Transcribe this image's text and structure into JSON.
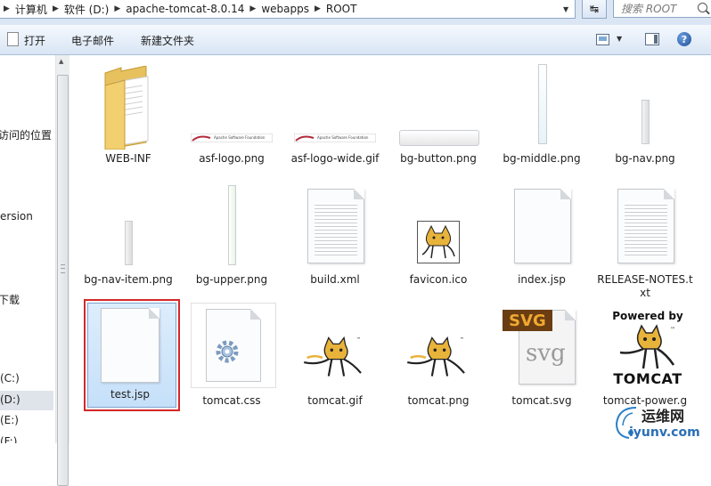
{
  "address_bar": {
    "crumbs": [
      "计算机",
      "软件 (D:)",
      "apache-tomcat-8.0.14",
      "webapps",
      "ROOT"
    ],
    "search_placeholder": "搜索 ROOT"
  },
  "toolbar": {
    "open_label": "打开",
    "email_label": "电子邮件",
    "new_folder_label": "新建文件夹"
  },
  "nav_pane": {
    "items": [
      "访问的位置",
      "ersion",
      "下载",
      "(C:)",
      "(D:)",
      "(E:)",
      "(F:)"
    ]
  },
  "files": [
    {
      "name": "WEB-INF",
      "icon": "folder-icon"
    },
    {
      "name": "asf-logo.png",
      "icon": "image-icon"
    },
    {
      "name": "asf-logo-wide.gif",
      "icon": "image-icon"
    },
    {
      "name": "bg-button.png",
      "icon": "image-icon"
    },
    {
      "name": "bg-middle.png",
      "icon": "image-icon"
    },
    {
      "name": "bg-nav.png",
      "icon": "image-icon"
    },
    {
      "name": "bg-nav-item.png",
      "icon": "image-icon"
    },
    {
      "name": "bg-upper.png",
      "icon": "image-icon"
    },
    {
      "name": "build.xml",
      "icon": "document-icon"
    },
    {
      "name": "favicon.ico",
      "icon": "tomcat-icon"
    },
    {
      "name": "index.jsp",
      "icon": "document-icon"
    },
    {
      "name": "RELEASE-NOTES.txt",
      "icon": "document-icon"
    },
    {
      "name": "test.jsp",
      "icon": "document-icon",
      "selected": true
    },
    {
      "name": "tomcat.css",
      "icon": "css-icon"
    },
    {
      "name": "tomcat.gif",
      "icon": "tomcat-icon"
    },
    {
      "name": "tomcat.png",
      "icon": "tomcat-icon"
    },
    {
      "name": "tomcat.svg",
      "icon": "svg-icon"
    },
    {
      "name": "tomcat-power.g",
      "icon": "tomcat-power-icon"
    }
  ],
  "thumb_text": {
    "asf_caption": "Apache Software Foundation",
    "svg_badge": "SVG",
    "svg_word": "svg",
    "powered_by": "Powered by",
    "tomcat_word": "TOMCAT"
  },
  "watermark": {
    "text_cn": "运维网",
    "text_en": "iyunv.com"
  },
  "colors": {
    "selection_border": "#d42828",
    "toolbar_bg": "#e5eef9",
    "accent_blue": "#1f4f9a"
  }
}
